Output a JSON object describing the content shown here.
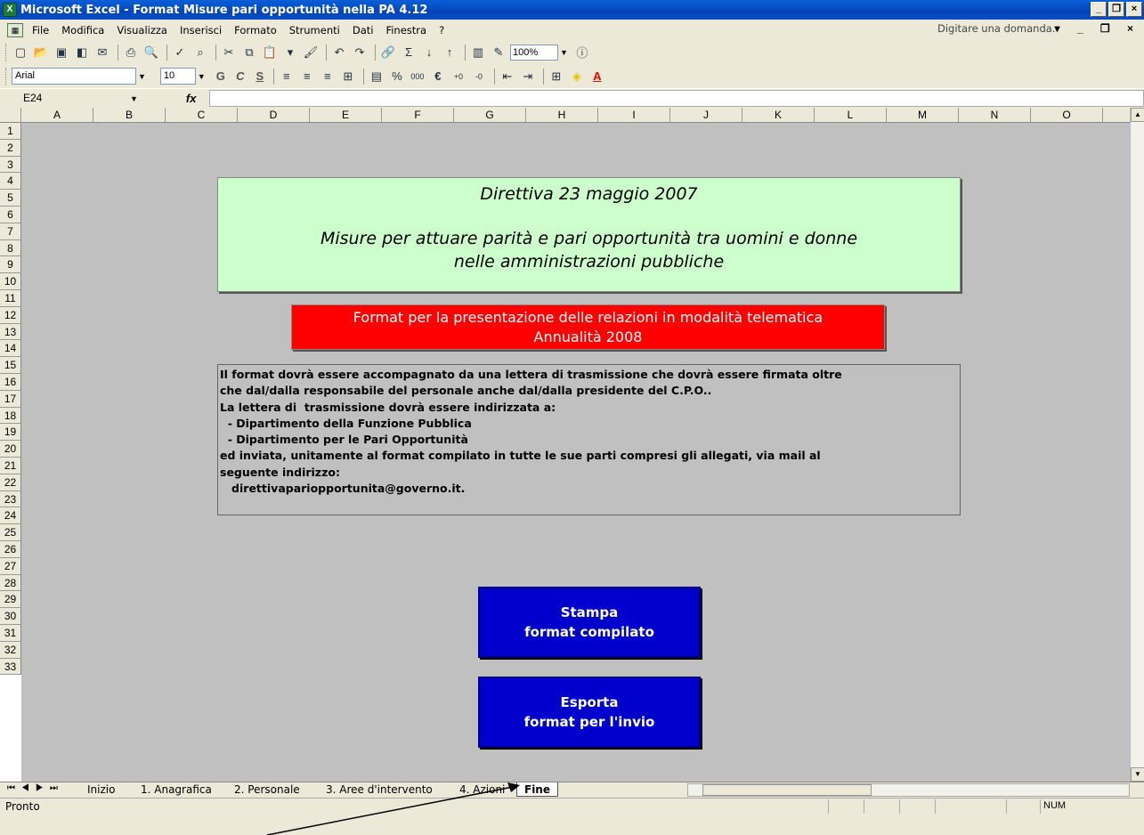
{
  "window": {
    "title": "Microsoft Excel - Format Misure pari opportunità nella PA 4.12"
  },
  "menu": {
    "items": [
      "File",
      "Modifica",
      "Visualizza",
      "Inserisci",
      "Formato",
      "Strumenti",
      "Dati",
      "Finestra",
      "?"
    ],
    "ask_placeholder": "Digitare una domanda."
  },
  "toolbar": {
    "zoom": "100%",
    "font": "Arial",
    "size": "10"
  },
  "formula": {
    "cell_ref": "E24",
    "fx": "fx",
    "value": ""
  },
  "columns": [
    "A",
    "B",
    "C",
    "D",
    "E",
    "F",
    "G",
    "H",
    "I",
    "J",
    "K",
    "L",
    "M",
    "N",
    "O"
  ],
  "rows": [
    "1",
    "2",
    "3",
    "4",
    "5",
    "6",
    "7",
    "8",
    "9",
    "10",
    "11",
    "12",
    "13",
    "14",
    "15",
    "16",
    "17",
    "18",
    "19",
    "20",
    "21",
    "22",
    "23",
    "24",
    "25",
    "26",
    "27",
    "28",
    "29",
    "30",
    "31",
    "32",
    "33"
  ],
  "sheet": {
    "header": {
      "line1": "Direttiva 23 maggio 2007",
      "line2": "Misure per attuare parità e pari opportunità tra uomini e donne",
      "line3": "nelle amministrazioni pubbliche"
    },
    "banner": {
      "line1": "Format per la presentazione delle relazioni in modalità telematica",
      "line2": "Annualità 2008"
    },
    "info": [
      "Il format dovrà essere accompagnato da una lettera di trasmissione che dovrà essere firmata oltre",
      "che dal/dalla responsabile del personale anche dal/dalla presidente del C.P.O..",
      "La lettera di  trasmissione dovrà essere indirizzata a:",
      "  - Dipartimento della Funzione Pubblica",
      "  - Dipartimento per le Pari Opportunità",
      "ed inviata, unitamente al format compilato in tutte le sue parti compresi gli allegati, via mail al",
      "seguente indirizzo:",
      "   direttivapariopportunita@governo.it."
    ],
    "print_button": {
      "line1": "Stampa",
      "line2": "format compilato"
    },
    "export_button": {
      "line1": "Esporta",
      "line2": "format per l'invio"
    }
  },
  "tabs": [
    "Inizio",
    "1. Anagrafica",
    "2. Personale",
    "3. Aree d'intervento",
    "4. Azioni",
    "Fine"
  ],
  "active_tab": "Fine",
  "status": {
    "text": "Pronto",
    "num": "NUM"
  }
}
